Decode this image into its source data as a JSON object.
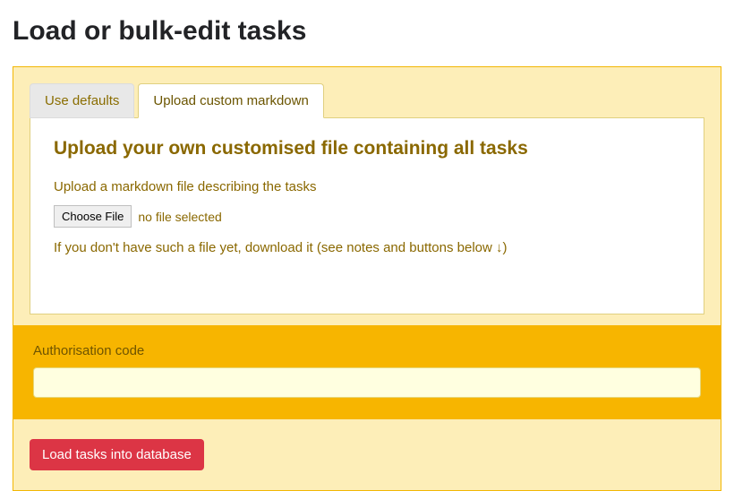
{
  "page": {
    "title": "Load or bulk-edit tasks"
  },
  "tabs": {
    "defaults": {
      "label": "Use defaults"
    },
    "upload": {
      "label": "Upload custom markdown"
    }
  },
  "upload_panel": {
    "heading": "Upload your own customised file containing all tasks",
    "description": "Upload a markdown file describing the tasks",
    "choose_file_label": "Choose File",
    "no_file_text": "no file selected",
    "download_note": "If you don't have such a file yet, download it (see notes and buttons below ↓)"
  },
  "auth": {
    "label": "Authorisation code",
    "value": ""
  },
  "submit": {
    "label": "Load tasks into database"
  }
}
